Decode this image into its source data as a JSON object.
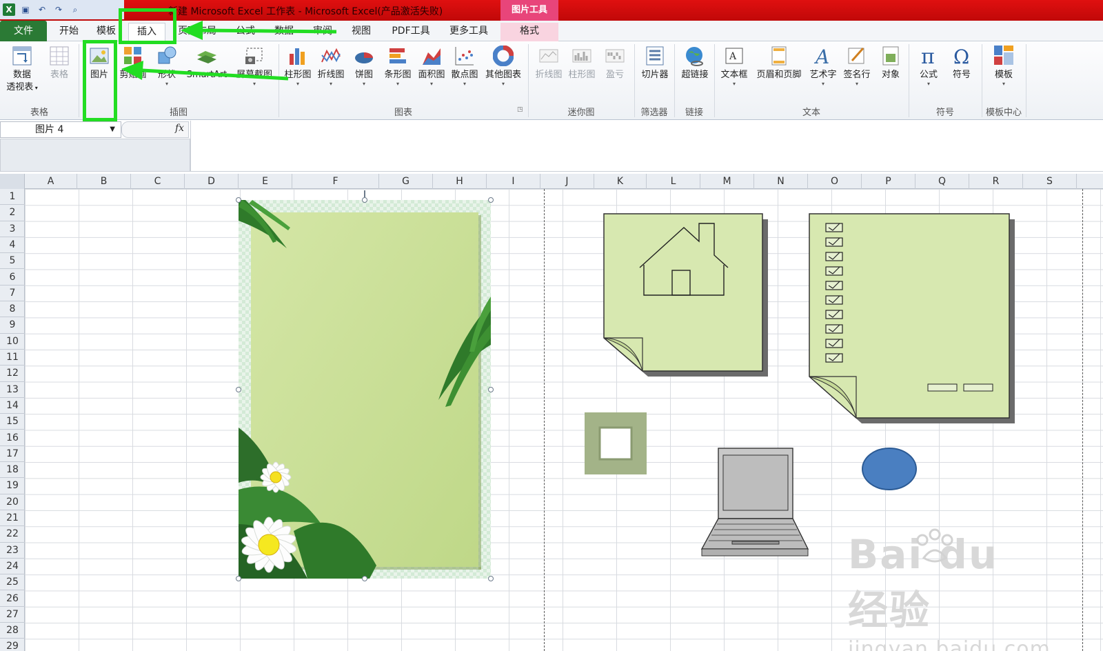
{
  "window": {
    "title": "新建 Microsoft Excel 工作表 - Microsoft Excel(产品激活失败)",
    "context_tab": "图片工具"
  },
  "qat": {
    "icons": [
      "excel-icon",
      "save-icon",
      "undo-icon",
      "redo-icon",
      "find-icon"
    ]
  },
  "tabs": [
    {
      "label": "文件"
    },
    {
      "label": "开始"
    },
    {
      "label": "模板"
    },
    {
      "label": "插入"
    },
    {
      "label": "页面布局"
    },
    {
      "label": "公式"
    },
    {
      "label": "数据"
    },
    {
      "label": "审阅"
    },
    {
      "label": "视图"
    },
    {
      "label": "PDF工具"
    },
    {
      "label": "更多工具"
    },
    {
      "label": "格式"
    }
  ],
  "ribbon": {
    "buttons": [
      {
        "label": "数据",
        "label2": "透视表"
      },
      {
        "label": "表格"
      },
      {
        "label": "图片"
      },
      {
        "label": "剪贴画"
      },
      {
        "label": "形状"
      },
      {
        "label": "SmartArt"
      },
      {
        "label": "屏幕截图"
      },
      {
        "label": "柱形图"
      },
      {
        "label": "折线图"
      },
      {
        "label": "饼图"
      },
      {
        "label": "条形图"
      },
      {
        "label": "面积图"
      },
      {
        "label": "散点图"
      },
      {
        "label": "其他图表"
      },
      {
        "label": "折线图"
      },
      {
        "label": "柱形图"
      },
      {
        "label": "盈亏"
      },
      {
        "label": "切片器"
      },
      {
        "label": "超链接"
      },
      {
        "label": "文本框"
      },
      {
        "label": "页眉和页脚"
      },
      {
        "label": "艺术字"
      },
      {
        "label": "签名行"
      },
      {
        "label": "对象"
      },
      {
        "label": "公式"
      },
      {
        "label": "符号"
      },
      {
        "label": "模板"
      }
    ],
    "groups": [
      {
        "label": "表格"
      },
      {
        "label": "插图"
      },
      {
        "label": "图表"
      },
      {
        "label": "迷你图"
      },
      {
        "label": "筛选器"
      },
      {
        "label": "链接"
      },
      {
        "label": "文本"
      },
      {
        "label": "符号"
      },
      {
        "label": "模板中心"
      }
    ]
  },
  "formula_bar": {
    "name_box": "图片 4",
    "fx": "fx"
  },
  "columns": [
    "A",
    "B",
    "C",
    "D",
    "E",
    "F",
    "G",
    "H",
    "I",
    "J",
    "K",
    "L",
    "M",
    "N",
    "O",
    "P",
    "Q",
    "R",
    "S"
  ],
  "rows": [
    "1",
    "2",
    "3",
    "4",
    "5",
    "6",
    "7",
    "8",
    "9",
    "10",
    "11",
    "12",
    "13",
    "14",
    "15",
    "16",
    "17",
    "18",
    "19",
    "20",
    "21",
    "22",
    "23",
    "24",
    "25",
    "26",
    "27",
    "28",
    "29"
  ],
  "watermark": {
    "brand": "Bai du 经验",
    "url": "jingyan.baidu.com"
  },
  "colors": {
    "title_bar": "#d00c0c",
    "file_tab": "#2b7a35",
    "highlight": "#22dd22",
    "note_fill": "#d7e8b0",
    "picture_fill": "#c9df9a",
    "oval_fill": "#4a7fc1",
    "frame_fill": "#a3b388"
  }
}
